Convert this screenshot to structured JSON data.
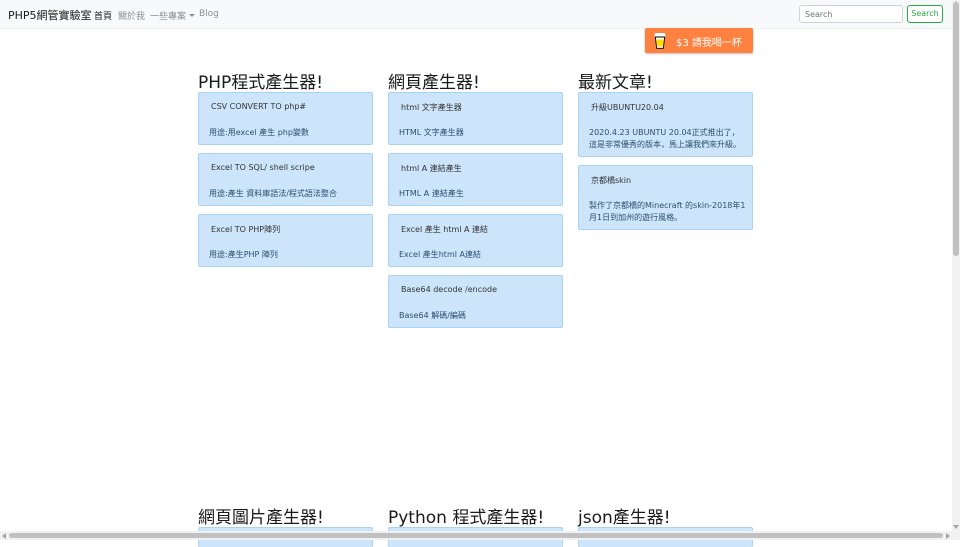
{
  "navbar": {
    "brand": "PHP5網管實驗室",
    "links": [
      {
        "label": "首頁",
        "active": true
      },
      {
        "label": "關於我",
        "active": false
      },
      {
        "label": "一些專案",
        "active": false
      },
      {
        "label": "Blog",
        "active": false
      }
    ],
    "search": {
      "placeholder": "Search",
      "value": ""
    },
    "search_button": "Search"
  },
  "coffee": {
    "label": "$3 請我喝一杯",
    "color": "#ff813f"
  },
  "sections": [
    {
      "title": "PHP程式產生器!",
      "cards": [
        {
          "title": "CSV CONVERT TO php#",
          "body": "用途:用excel 產生 php變數"
        },
        {
          "title": "Excel TO SQL/ shell scripe",
          "body": "用途:產生 資料庫語法/程式語法整合"
        },
        {
          "title": "Excel TO PHP陣列",
          "body": "用途:產生PHP 陣列"
        }
      ]
    },
    {
      "title": "網頁產生器!",
      "cards": [
        {
          "title": "html 文字產生器",
          "body": "HTML 文字產生器"
        },
        {
          "title": "html A 連結產生",
          "body": "HTML A 連結產生"
        },
        {
          "title": "Excel 產生 html A 連結",
          "body": "Excel 產生html A連結"
        },
        {
          "title": "Base64 decode /encode",
          "body": "Base64 解碼/編碼"
        }
      ]
    },
    {
      "title": "最新文章!",
      "cards": [
        {
          "title": "升級UBUNTU20.04",
          "body": "2020.4.23 UBUNTU 20.04正式推出了，這是非常優秀的版本，馬上讓我們來升級。"
        },
        {
          "title": "京都橋skin",
          "body": "製作了京都橋的Minecraft 的skin-2018年1月1日到加州的遊行風格。"
        }
      ]
    },
    {
      "title": "網頁圖片產生器!",
      "cards": []
    },
    {
      "title": "Python 程式產生器!",
      "cards": []
    },
    {
      "title": "json產生器!",
      "cards": []
    }
  ],
  "colors": {
    "card_bg": "#cce5fb",
    "card_border": "#a9d3f3",
    "accent_green": "#28a745",
    "coffee_orange": "#ff813f"
  },
  "icons": [
    "coffee-cup-icon",
    "dropdown-caret-icon"
  ]
}
